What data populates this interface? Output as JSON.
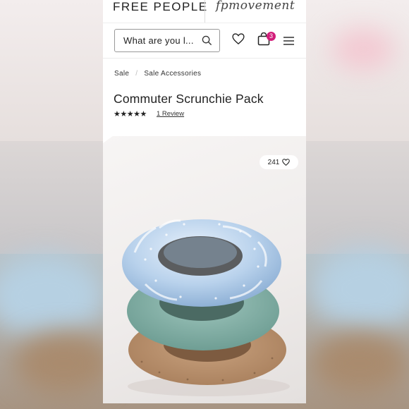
{
  "header": {
    "brand": "FREE PEOPLE",
    "sub_brand": "fpmovement"
  },
  "search": {
    "placeholder": "What are you l..."
  },
  "cart": {
    "count": "3"
  },
  "breadcrumb": {
    "items": [
      "Sale",
      "Sale Accessories"
    ],
    "separator": "/"
  },
  "product": {
    "title": "Commuter Scrunchie Pack",
    "rating_stars": "★★★★★",
    "reviews": "1 Review",
    "likes": "241"
  },
  "icons": {
    "search": "search-icon",
    "wishlist": "heart-icon",
    "bag": "shopping-bag-icon",
    "menu": "hamburger-menu-icon",
    "like": "heart-icon"
  },
  "colors": {
    "badge": "#d21e7a",
    "text": "#222222"
  }
}
